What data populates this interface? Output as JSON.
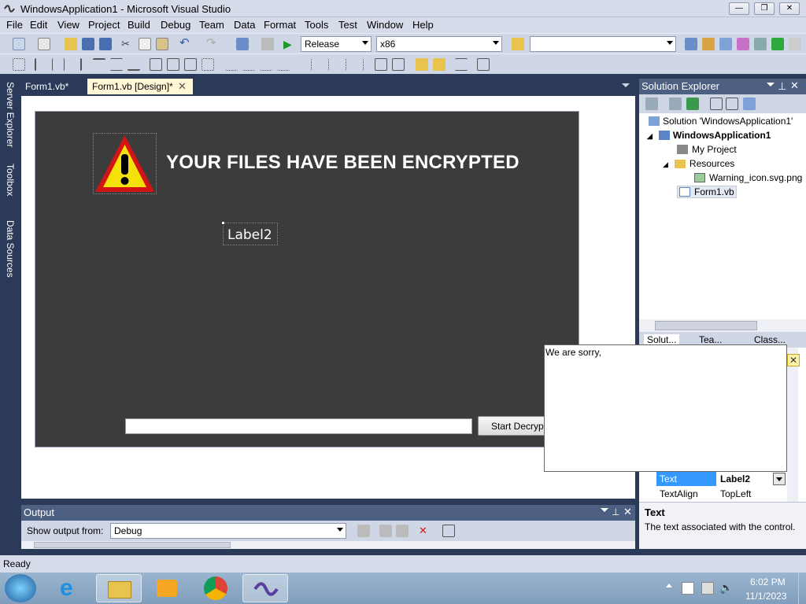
{
  "window": {
    "title": "WindowsApplication1 - Microsoft Visual Studio"
  },
  "menu": [
    "File",
    "Edit",
    "View",
    "Project",
    "Build",
    "Debug",
    "Team",
    "Data",
    "Format",
    "Tools",
    "Test",
    "Window",
    "Help"
  ],
  "toolbar": {
    "config": "Release",
    "platform": "x86",
    "find": ""
  },
  "left_tabs": [
    "Server Explorer",
    "Toolbox",
    "Data Sources"
  ],
  "doc_tabs": [
    {
      "label": "Form1.vb*"
    },
    {
      "label": "Form1.vb [Design]*"
    }
  ],
  "form": {
    "heading": "YOUR FILES HAVE BEEN ENCRYPTED",
    "label2": "Label2",
    "textbox": "",
    "button": "Start Decryption"
  },
  "popup": {
    "text": "We are sorry,"
  },
  "output": {
    "title": "Output",
    "show_from_label": "Show output from:",
    "show_from_value": "Debug"
  },
  "solution": {
    "title": "Solution Explorer",
    "tree": [
      {
        "label": "Solution 'WindowsApplication1'"
      },
      {
        "label": "WindowsApplication1"
      },
      {
        "label": "My Project"
      },
      {
        "label": "Resources"
      },
      {
        "label": "Warning_icon.svg.png"
      },
      {
        "label": "Form1.vb"
      }
    ],
    "tabs": [
      "Solut...",
      "Tea...",
      "Class..."
    ]
  },
  "properties": {
    "rows": [
      {
        "name": "Text",
        "value": "Label2"
      },
      {
        "name": "TextAlign",
        "value": "TopLeft"
      }
    ],
    "desc_title": "Text",
    "desc_body": "The text associated with the control."
  },
  "status": {
    "text": "Ready"
  },
  "taskbar": {
    "time": "6:02 PM",
    "date": "11/1/2023"
  },
  "colors": {
    "accent": "#3399ff",
    "form_bg": "#3c3c3c",
    "chrome": "#2b3a58"
  }
}
